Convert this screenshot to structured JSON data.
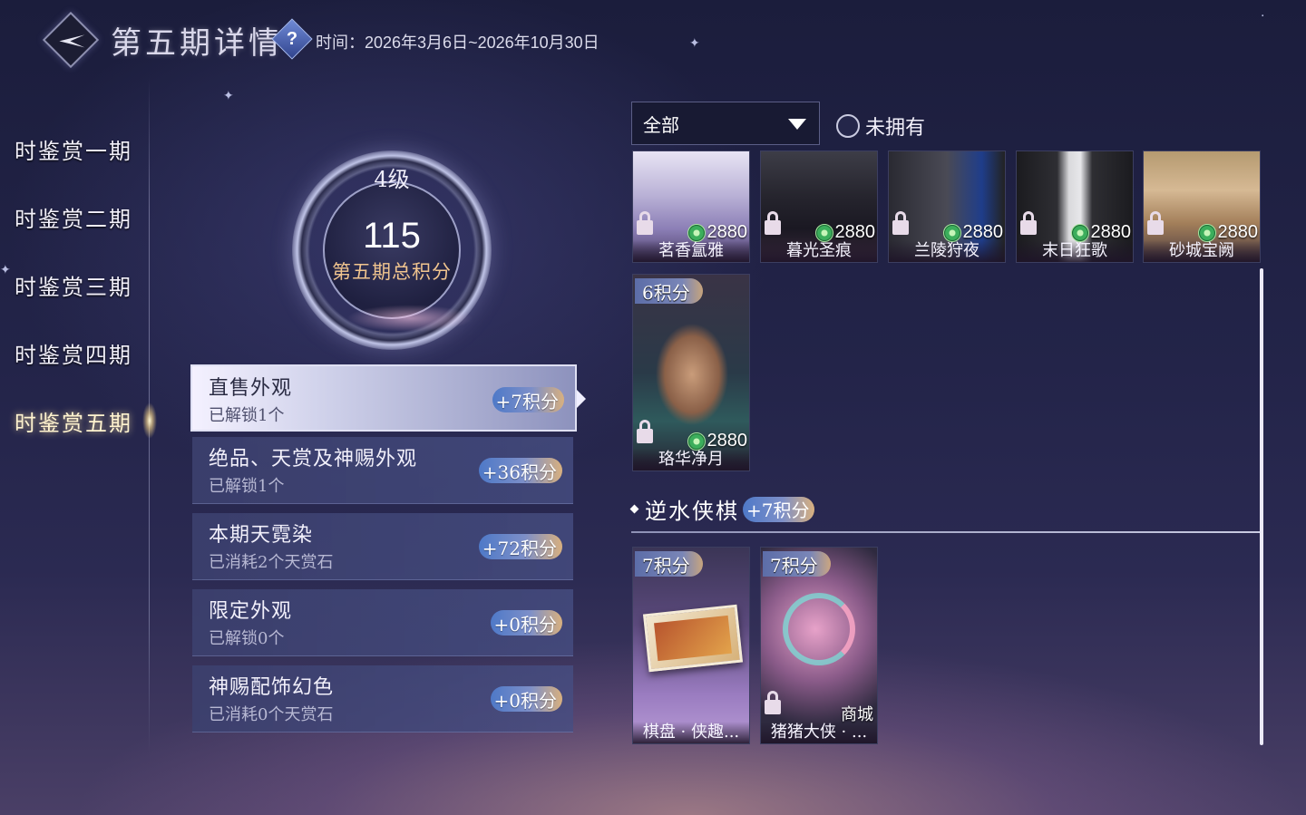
{
  "header": {
    "title": "第五期详情",
    "help_symbol": "?",
    "time_text": "时间：2026年3月6日~2026年10月30日"
  },
  "nav": {
    "items": [
      {
        "label": "时鉴赏一期"
      },
      {
        "label": "时鉴赏二期"
      },
      {
        "label": "时鉴赏三期"
      },
      {
        "label": "时鉴赏四期"
      },
      {
        "label": "时鉴赏五期",
        "active": true
      }
    ]
  },
  "score": {
    "level": "4级",
    "total": "115",
    "label": "第五期总积分"
  },
  "categories": [
    {
      "title": "直售外观",
      "sub": "已解锁1个",
      "points": "+7积分",
      "active": true
    },
    {
      "title": "绝品、天赏及神赐外观",
      "sub": "已解锁1个",
      "points": "+36积分"
    },
    {
      "title": "本期天霓染",
      "sub": "已消耗2个天赏石",
      "points": "+72积分"
    },
    {
      "title": "限定外观",
      "sub": "已解锁0个",
      "points": "+0积分"
    },
    {
      "title": "神赐配饰幻色",
      "sub": "已消耗0个天赏石",
      "points": "+0积分"
    }
  ],
  "filter": {
    "dropdown_value": "全部",
    "radio_label": "未拥有"
  },
  "items_row1": [
    {
      "name": "茗香氲雅",
      "price": "2880"
    },
    {
      "name": "暮光圣痕",
      "price": "2880"
    },
    {
      "name": "兰陵狩夜",
      "price": "2880"
    },
    {
      "name": "末日狂歌",
      "price": "2880"
    },
    {
      "name": "砂城宝阙",
      "price": "2880"
    }
  ],
  "featured_item": {
    "name": "珞华净月",
    "price": "2880",
    "points": "6积分"
  },
  "section": {
    "title": "逆水侠棋",
    "points": "+7积分"
  },
  "section_items": [
    {
      "name": "棋盘 · 侠趣...",
      "points": "7积分"
    },
    {
      "name": "猪猪大侠 · ...",
      "points": "7积分",
      "shop": "商城"
    }
  ],
  "colors": {
    "accent_gold": "#f1c58f",
    "coin_green": "#3cae5c",
    "panel_bg": "#3c406e"
  }
}
